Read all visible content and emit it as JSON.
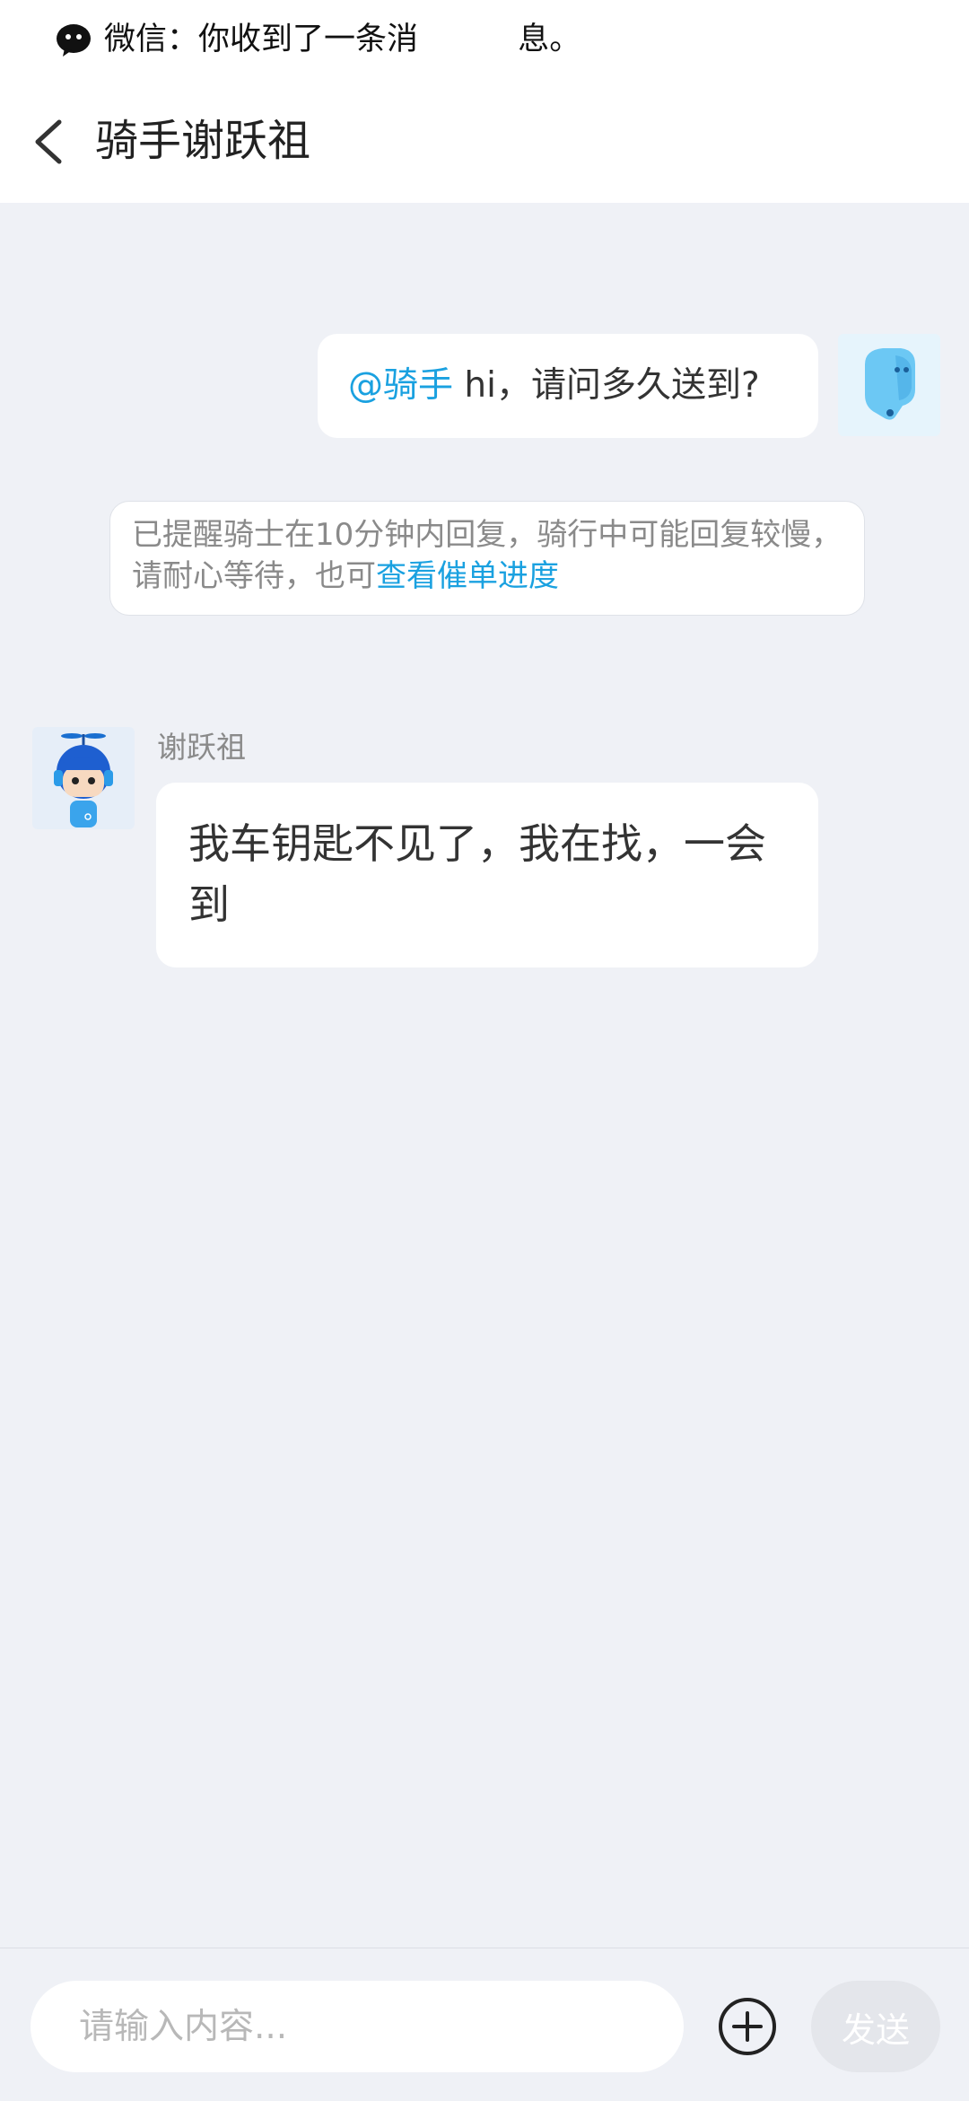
{
  "notification": {
    "text": "微信：你收到了一条消          息。"
  },
  "header": {
    "title": "骑手谢跃祖"
  },
  "messages": {
    "outgoing": {
      "mention": "@骑手",
      "text": " hi，请问多久送到?"
    },
    "system": {
      "text": "已提醒骑士在10分钟内回复，骑行中可能回复较慢，请耐心等待，也可",
      "link": "查看催单进度"
    },
    "incoming": {
      "sender": "谢跃祖",
      "text": "我车钥匙不见了，我在找，一会到"
    }
  },
  "composer": {
    "placeholder": "请输入内容...",
    "send_label": "发送"
  },
  "colors": {
    "accent": "#1aa1e0",
    "background": "#eff1f6"
  },
  "icons": {
    "notification": "wechat-icon",
    "back": "back-arrow-icon",
    "plus": "plus-circle-icon"
  }
}
